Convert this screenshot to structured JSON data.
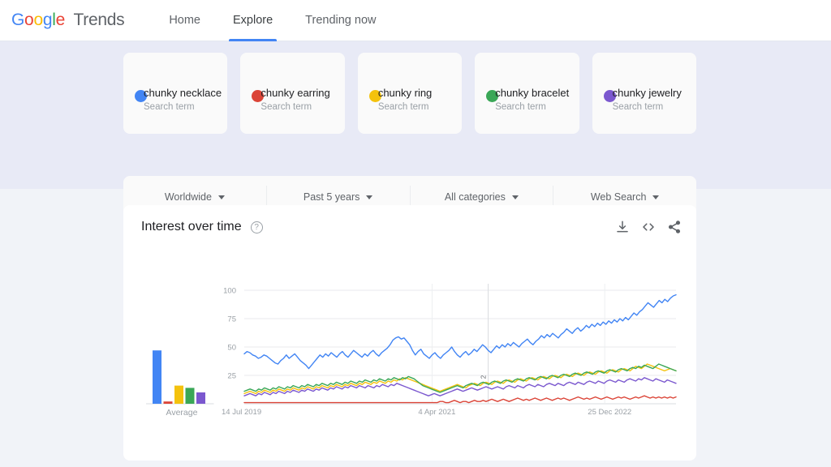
{
  "header": {
    "logo_google": "Google",
    "logo_trends": "Trends",
    "nav": [
      {
        "label": "Home",
        "active": false
      },
      {
        "label": "Explore",
        "active": true
      },
      {
        "label": "Trending now",
        "active": false
      }
    ]
  },
  "terms": [
    {
      "title": "chunky necklace",
      "subtitle": "Search term",
      "color": "#4285f4"
    },
    {
      "title": "chunky earring",
      "subtitle": "Search term",
      "color": "#db4437"
    },
    {
      "title": "chunky ring",
      "subtitle": "Search term",
      "color": "#f4c20d"
    },
    {
      "title": "chunky bracelet",
      "subtitle": "Search term",
      "color": "#3aa757"
    },
    {
      "title": "chunky jewelry",
      "subtitle": "Search term",
      "color": "#7b58cf"
    }
  ],
  "filters": [
    {
      "label": "Worldwide"
    },
    {
      "label": "Past 5 years"
    },
    {
      "label": "All categories"
    },
    {
      "label": "Web Search"
    }
  ],
  "card": {
    "title": "Interest over time",
    "help_icon": "help-circle-icon",
    "actions": [
      {
        "name": "download-icon"
      },
      {
        "name": "embed-code-icon"
      },
      {
        "name": "share-icon"
      }
    ]
  },
  "chart_data": {
    "type": "line",
    "title": "Interest over time",
    "xlabel": "",
    "ylabel": "",
    "ylim": [
      0,
      100
    ],
    "y_ticks": [
      25,
      50,
      75,
      100
    ],
    "x_tick_labels": [
      "14 Jul 2019",
      "4 Apr 2021",
      "25 Dec 2022"
    ],
    "x_tick_positions": [
      0,
      0.435,
      0.835
    ],
    "grid": true,
    "legend_position": "top-cards",
    "marker_annotation": "2",
    "marker_position": 0.565,
    "average_panel": {
      "label": "Average",
      "values": [
        47,
        2,
        16,
        14,
        10
      ]
    },
    "series": [
      {
        "name": "chunky necklace",
        "color": "#4285f4",
        "values": [
          44,
          46,
          45,
          43,
          42,
          40,
          41,
          43,
          42,
          40,
          38,
          36,
          35,
          38,
          40,
          43,
          40,
          42,
          44,
          41,
          38,
          36,
          34,
          31,
          34,
          37,
          40,
          43,
          41,
          44,
          42,
          45,
          43,
          41,
          44,
          46,
          43,
          41,
          44,
          47,
          45,
          43,
          41,
          44,
          42,
          45,
          47,
          44,
          42,
          45,
          47,
          49,
          52,
          56,
          58,
          59,
          57,
          58,
          55,
          52,
          47,
          43,
          46,
          48,
          44,
          42,
          40,
          43,
          45,
          42,
          40,
          43,
          45,
          47,
          50,
          46,
          43,
          41,
          44,
          46,
          43,
          45,
          48,
          46,
          49,
          52,
          50,
          47,
          45,
          48,
          51,
          49,
          52,
          50,
          53,
          51,
          54,
          52,
          50,
          53,
          55,
          57,
          54,
          52,
          55,
          57,
          60,
          58,
          61,
          59,
          62,
          60,
          58,
          61,
          63,
          66,
          64,
          62,
          65,
          67,
          64,
          66,
          69,
          67,
          70,
          68,
          71,
          69,
          72,
          70,
          73,
          71,
          74,
          72,
          75,
          73,
          76,
          74,
          77,
          80,
          78,
          81,
          83,
          86,
          89,
          87,
          85,
          88,
          91,
          89,
          92,
          90,
          93,
          95,
          96
        ]
      },
      {
        "name": "chunky earring",
        "color": "#db4437",
        "values": [
          1,
          1,
          1,
          1,
          1,
          1,
          1,
          1,
          1,
          1,
          1,
          1,
          1,
          1,
          1,
          1,
          1,
          1,
          1,
          1,
          1,
          1,
          1,
          1,
          1,
          1,
          1,
          1,
          1,
          1,
          1,
          1,
          1,
          1,
          1,
          1,
          1,
          1,
          1,
          1,
          1,
          1,
          1,
          1,
          1,
          1,
          1,
          1,
          1,
          1,
          1,
          1,
          1,
          1,
          1,
          1,
          1,
          1,
          1,
          1,
          1,
          1,
          1,
          1,
          1,
          1,
          1,
          1,
          2,
          2,
          1,
          1,
          2,
          3,
          2,
          1,
          2,
          2,
          1,
          2,
          3,
          2,
          2,
          3,
          2,
          3,
          4,
          3,
          2,
          3,
          4,
          3,
          2,
          3,
          4,
          5,
          4,
          3,
          4,
          3,
          4,
          5,
          4,
          3,
          4,
          5,
          4,
          3,
          4,
          5,
          4,
          5,
          4,
          3,
          4,
          5,
          6,
          5,
          4,
          5,
          4,
          5,
          6,
          5,
          4,
          5,
          6,
          5,
          4,
          5,
          6,
          5,
          6,
          5,
          4,
          5,
          6,
          5,
          6,
          7,
          6,
          5,
          6,
          5,
          6,
          5,
          6,
          5,
          6,
          5,
          6
        ]
      },
      {
        "name": "chunky ring",
        "color": "#f4c20d",
        "values": [
          9,
          10,
          11,
          10,
          9,
          11,
          10,
          12,
          11,
          10,
          12,
          11,
          13,
          12,
          11,
          13,
          12,
          14,
          13,
          12,
          14,
          13,
          15,
          14,
          13,
          15,
          14,
          16,
          15,
          14,
          16,
          15,
          17,
          16,
          15,
          17,
          16,
          18,
          17,
          16,
          18,
          17,
          19,
          18,
          17,
          19,
          18,
          20,
          19,
          18,
          20,
          19,
          21,
          20,
          22,
          21,
          23,
          22,
          21,
          20,
          19,
          18,
          17,
          16,
          15,
          14,
          13,
          12,
          11,
          12,
          13,
          14,
          15,
          16,
          17,
          16,
          15,
          14,
          16,
          17,
          18,
          17,
          16,
          18,
          19,
          18,
          17,
          19,
          20,
          19,
          18,
          20,
          21,
          20,
          19,
          21,
          22,
          21,
          20,
          22,
          23,
          22,
          21,
          23,
          24,
          23,
          22,
          24,
          25,
          24,
          23,
          25,
          26,
          25,
          24,
          26,
          27,
          26,
          25,
          27,
          28,
          27,
          26,
          28,
          29,
          28,
          27,
          29,
          30,
          29,
          28,
          30,
          31,
          30,
          29,
          31,
          33,
          32,
          31,
          33,
          35,
          34,
          33,
          32,
          31,
          30,
          29,
          30,
          31,
          30,
          29
        ]
      },
      {
        "name": "chunky bracelet",
        "color": "#3aa757",
        "values": [
          11,
          12,
          13,
          12,
          11,
          13,
          12,
          14,
          13,
          12,
          14,
          13,
          15,
          14,
          13,
          15,
          14,
          16,
          15,
          14,
          16,
          15,
          17,
          16,
          15,
          17,
          16,
          18,
          17,
          16,
          18,
          17,
          19,
          18,
          17,
          19,
          18,
          20,
          19,
          18,
          20,
          19,
          21,
          20,
          19,
          21,
          20,
          22,
          21,
          20,
          22,
          21,
          23,
          22,
          21,
          23,
          22,
          24,
          23,
          22,
          20,
          18,
          16,
          15,
          14,
          13,
          12,
          11,
          10,
          11,
          12,
          13,
          14,
          15,
          16,
          15,
          14,
          16,
          17,
          18,
          17,
          16,
          18,
          19,
          18,
          17,
          19,
          20,
          19,
          18,
          20,
          21,
          20,
          19,
          21,
          22,
          21,
          20,
          22,
          23,
          22,
          21,
          23,
          24,
          23,
          22,
          24,
          25,
          24,
          23,
          25,
          26,
          25,
          24,
          26,
          27,
          26,
          25,
          27,
          28,
          27,
          26,
          28,
          29,
          28,
          27,
          29,
          30,
          29,
          28,
          30,
          31,
          30,
          29,
          31,
          32,
          31,
          33,
          32,
          34,
          33,
          32,
          31,
          33,
          35,
          34,
          33,
          32,
          31,
          30,
          29
        ]
      },
      {
        "name": "chunky jewelry",
        "color": "#7b58cf",
        "values": [
          7,
          8,
          9,
          8,
          7,
          9,
          8,
          10,
          9,
          8,
          10,
          9,
          11,
          10,
          9,
          11,
          10,
          12,
          11,
          10,
          12,
          11,
          13,
          12,
          11,
          13,
          12,
          14,
          13,
          12,
          14,
          13,
          15,
          14,
          13,
          15,
          14,
          16,
          15,
          14,
          16,
          15,
          14,
          16,
          15,
          14,
          16,
          15,
          17,
          16,
          15,
          17,
          16,
          18,
          17,
          16,
          15,
          14,
          13,
          12,
          11,
          10,
          9,
          8,
          7,
          8,
          9,
          8,
          7,
          8,
          9,
          10,
          11,
          12,
          13,
          12,
          11,
          12,
          13,
          14,
          13,
          12,
          13,
          14,
          15,
          14,
          13,
          14,
          15,
          14,
          13,
          15,
          16,
          15,
          14,
          16,
          15,
          14,
          16,
          17,
          16,
          15,
          17,
          16,
          15,
          17,
          18,
          17,
          16,
          18,
          17,
          16,
          18,
          19,
          18,
          17,
          19,
          18,
          17,
          19,
          20,
          19,
          18,
          20,
          19,
          18,
          20,
          21,
          20,
          19,
          21,
          20,
          19,
          21,
          22,
          21,
          20,
          22,
          21,
          23,
          22,
          21,
          20,
          22,
          21,
          20,
          19,
          21,
          20,
          19,
          18
        ]
      }
    ]
  }
}
